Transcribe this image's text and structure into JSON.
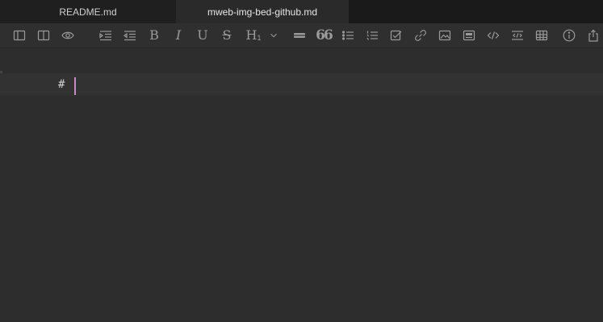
{
  "tabs": [
    {
      "label": "README.md",
      "active": false
    },
    {
      "label": "mweb-img-bed-github.md",
      "active": true
    }
  ],
  "toolbar": {
    "icons": [
      "sidebar-icon",
      "split-view-icon",
      "preview-eye-icon",
      "indent-icon",
      "outdent-icon",
      "bold-icon",
      "italic-icon",
      "underline-icon",
      "strikethrough-icon",
      "heading-icon",
      "chevron-down-icon",
      "horizontal-rule-icon",
      "quote-icon",
      "bullet-list-icon",
      "numbered-list-icon",
      "task-list-icon",
      "link-icon",
      "image-icon",
      "image-gallery-icon",
      "code-icon",
      "code-block-icon",
      "table-icon",
      "info-icon",
      "share-icon"
    ],
    "bold_glyph": "B",
    "italic_glyph": "I",
    "underline_glyph": "U",
    "strike_glyph": "S",
    "heading_glyph": "H",
    "heading_sub": "1",
    "quote_glyph": "66"
  },
  "editor": {
    "line_text": "#"
  },
  "colors": {
    "caret": "#c28bc4",
    "background": "#2d2d2d",
    "tabbar": "#1c1c1c"
  }
}
